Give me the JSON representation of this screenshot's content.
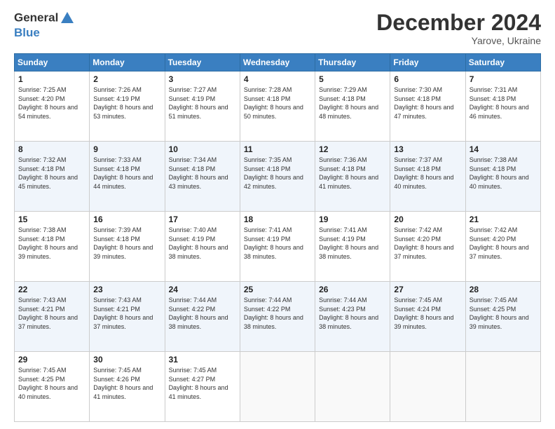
{
  "header": {
    "logo_line1": "General",
    "logo_line2": "Blue",
    "main_title": "December 2024",
    "subtitle": "Yarove, Ukraine"
  },
  "days_of_week": [
    "Sunday",
    "Monday",
    "Tuesday",
    "Wednesday",
    "Thursday",
    "Friday",
    "Saturday"
  ],
  "weeks": [
    [
      {
        "day": 1,
        "sunrise": "7:25 AM",
        "sunset": "4:20 PM",
        "daylight": "8 hours and 54 minutes."
      },
      {
        "day": 2,
        "sunrise": "7:26 AM",
        "sunset": "4:19 PM",
        "daylight": "8 hours and 53 minutes."
      },
      {
        "day": 3,
        "sunrise": "7:27 AM",
        "sunset": "4:19 PM",
        "daylight": "8 hours and 51 minutes."
      },
      {
        "day": 4,
        "sunrise": "7:28 AM",
        "sunset": "4:18 PM",
        "daylight": "8 hours and 50 minutes."
      },
      {
        "day": 5,
        "sunrise": "7:29 AM",
        "sunset": "4:18 PM",
        "daylight": "8 hours and 48 minutes."
      },
      {
        "day": 6,
        "sunrise": "7:30 AM",
        "sunset": "4:18 PM",
        "daylight": "8 hours and 47 minutes."
      },
      {
        "day": 7,
        "sunrise": "7:31 AM",
        "sunset": "4:18 PM",
        "daylight": "8 hours and 46 minutes."
      }
    ],
    [
      {
        "day": 8,
        "sunrise": "7:32 AM",
        "sunset": "4:18 PM",
        "daylight": "8 hours and 45 minutes."
      },
      {
        "day": 9,
        "sunrise": "7:33 AM",
        "sunset": "4:18 PM",
        "daylight": "8 hours and 44 minutes."
      },
      {
        "day": 10,
        "sunrise": "7:34 AM",
        "sunset": "4:18 PM",
        "daylight": "8 hours and 43 minutes."
      },
      {
        "day": 11,
        "sunrise": "7:35 AM",
        "sunset": "4:18 PM",
        "daylight": "8 hours and 42 minutes."
      },
      {
        "day": 12,
        "sunrise": "7:36 AM",
        "sunset": "4:18 PM",
        "daylight": "8 hours and 41 minutes."
      },
      {
        "day": 13,
        "sunrise": "7:37 AM",
        "sunset": "4:18 PM",
        "daylight": "8 hours and 40 minutes."
      },
      {
        "day": 14,
        "sunrise": "7:38 AM",
        "sunset": "4:18 PM",
        "daylight": "8 hours and 40 minutes."
      }
    ],
    [
      {
        "day": 15,
        "sunrise": "7:38 AM",
        "sunset": "4:18 PM",
        "daylight": "8 hours and 39 minutes."
      },
      {
        "day": 16,
        "sunrise": "7:39 AM",
        "sunset": "4:18 PM",
        "daylight": "8 hours and 39 minutes."
      },
      {
        "day": 17,
        "sunrise": "7:40 AM",
        "sunset": "4:19 PM",
        "daylight": "8 hours and 38 minutes."
      },
      {
        "day": 18,
        "sunrise": "7:41 AM",
        "sunset": "4:19 PM",
        "daylight": "8 hours and 38 minutes."
      },
      {
        "day": 19,
        "sunrise": "7:41 AM",
        "sunset": "4:19 PM",
        "daylight": "8 hours and 38 minutes."
      },
      {
        "day": 20,
        "sunrise": "7:42 AM",
        "sunset": "4:20 PM",
        "daylight": "8 hours and 37 minutes."
      },
      {
        "day": 21,
        "sunrise": "7:42 AM",
        "sunset": "4:20 PM",
        "daylight": "8 hours and 37 minutes."
      }
    ],
    [
      {
        "day": 22,
        "sunrise": "7:43 AM",
        "sunset": "4:21 PM",
        "daylight": "8 hours and 37 minutes."
      },
      {
        "day": 23,
        "sunrise": "7:43 AM",
        "sunset": "4:21 PM",
        "daylight": "8 hours and 37 minutes."
      },
      {
        "day": 24,
        "sunrise": "7:44 AM",
        "sunset": "4:22 PM",
        "daylight": "8 hours and 38 minutes."
      },
      {
        "day": 25,
        "sunrise": "7:44 AM",
        "sunset": "4:22 PM",
        "daylight": "8 hours and 38 minutes."
      },
      {
        "day": 26,
        "sunrise": "7:44 AM",
        "sunset": "4:23 PM",
        "daylight": "8 hours and 38 minutes."
      },
      {
        "day": 27,
        "sunrise": "7:45 AM",
        "sunset": "4:24 PM",
        "daylight": "8 hours and 39 minutes."
      },
      {
        "day": 28,
        "sunrise": "7:45 AM",
        "sunset": "4:25 PM",
        "daylight": "8 hours and 39 minutes."
      }
    ],
    [
      {
        "day": 29,
        "sunrise": "7:45 AM",
        "sunset": "4:25 PM",
        "daylight": "8 hours and 40 minutes."
      },
      {
        "day": 30,
        "sunrise": "7:45 AM",
        "sunset": "4:26 PM",
        "daylight": "8 hours and 41 minutes."
      },
      {
        "day": 31,
        "sunrise": "7:45 AM",
        "sunset": "4:27 PM",
        "daylight": "8 hours and 41 minutes."
      },
      null,
      null,
      null,
      null
    ]
  ],
  "labels": {
    "sunrise": "Sunrise:",
    "sunset": "Sunset:",
    "daylight": "Daylight:"
  }
}
